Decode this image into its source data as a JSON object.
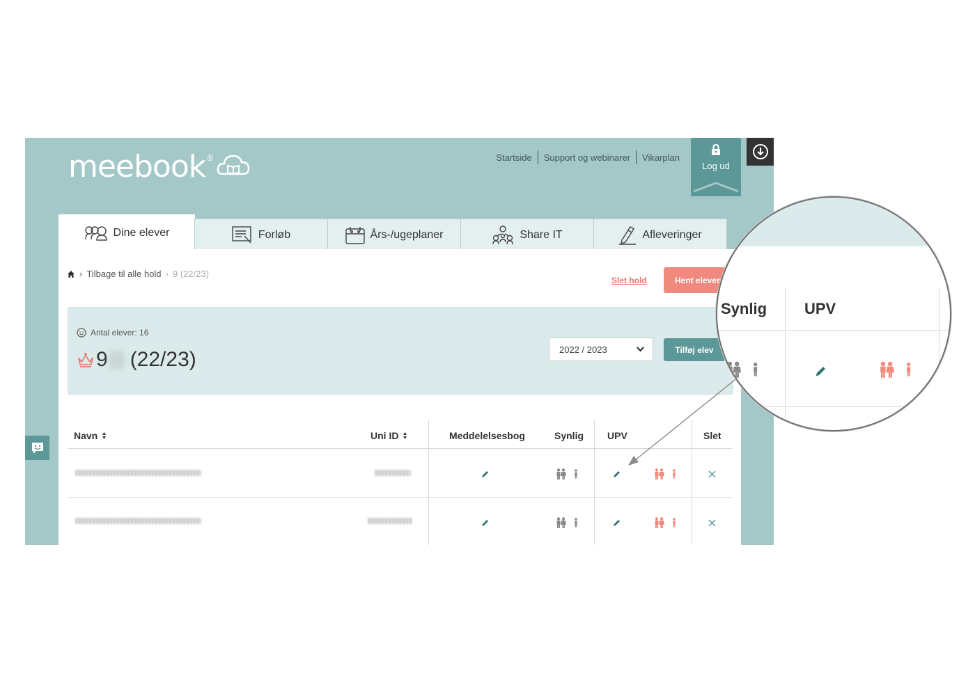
{
  "brand": {
    "name": "meebook",
    "reg": "®"
  },
  "topnav": {
    "items": [
      "Startside",
      "Support og webinarer",
      "Vikarplan"
    ],
    "logout": "Log ud"
  },
  "tabs": [
    {
      "label": "Dine elever",
      "icon": "students-icon"
    },
    {
      "label": "Forløb",
      "icon": "course-icon"
    },
    {
      "label": "Års-/ugeplaner",
      "icon": "calendar-icon"
    },
    {
      "label": "Share IT",
      "icon": "share-icon"
    },
    {
      "label": "Afleveringer",
      "icon": "pen-icon"
    }
  ],
  "breadcrumb": {
    "back": "Tilbage til alle hold",
    "current": "9 (22/23)"
  },
  "actions": {
    "delete_team": "Slet hold",
    "fetch_students": "Hent elever",
    "add_student": "Tilføj elev"
  },
  "class_info": {
    "count_label": "Antal elever: 16",
    "title_prefix": "9",
    "title_suffix": "(22/23)",
    "school_year": "2022 / 2023"
  },
  "table": {
    "headers": {
      "name": "Navn",
      "uni_id": "Uni ID",
      "message_book": "Meddelelsesbog",
      "visible": "Synlig",
      "upv": "UPV",
      "delete": "Slet"
    },
    "rows": [
      {
        "name": "",
        "uni_id": ""
      },
      {
        "name": "",
        "uni_id": ""
      }
    ]
  },
  "zoom": {
    "headers": [
      "Synlig",
      "UPV"
    ]
  },
  "colors": {
    "teal": "#a4c8c8",
    "teal_dark": "#5c9898",
    "coral": "#f08a7e",
    "coral_text": "#e8776b"
  }
}
